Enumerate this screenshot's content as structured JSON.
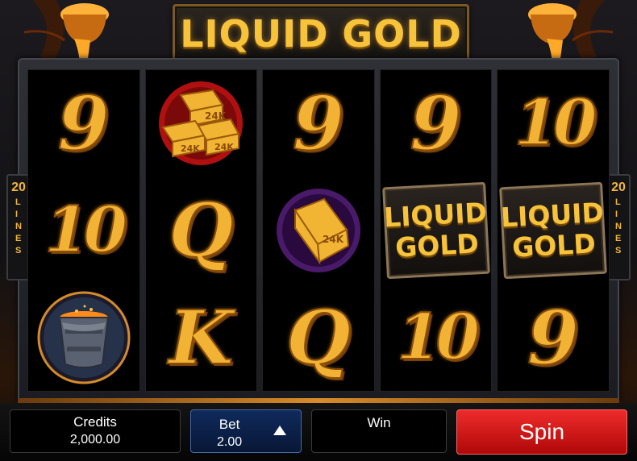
{
  "title": "LIQUID GOLD",
  "side_lines": {
    "number": "20",
    "word": [
      "L",
      "I",
      "N",
      "E",
      "S"
    ]
  },
  "reels": [
    [
      {
        "kind": "letter",
        "text": "9"
      },
      {
        "kind": "letter",
        "text": "10"
      },
      {
        "kind": "bucket",
        "text": ""
      }
    ],
    [
      {
        "kind": "goldbars",
        "text": "24K"
      },
      {
        "kind": "letter",
        "text": "Q"
      },
      {
        "kind": "letter",
        "text": "K"
      }
    ],
    [
      {
        "kind": "letter",
        "text": "9"
      },
      {
        "kind": "goldbar",
        "text": "24K"
      },
      {
        "kind": "letter",
        "text": "Q"
      }
    ],
    [
      {
        "kind": "letter",
        "text": "9"
      },
      {
        "kind": "logo",
        "text": [
          "LIQUID",
          "GOLD"
        ]
      },
      {
        "kind": "letter",
        "text": "10"
      }
    ],
    [
      {
        "kind": "letter",
        "text": "10"
      },
      {
        "kind": "logo",
        "text": [
          "LIQUID",
          "GOLD"
        ]
      },
      {
        "kind": "letter",
        "text": "9"
      }
    ]
  ],
  "panel": {
    "credits_label": "Credits",
    "credits_value": "2,000.00",
    "bet_label": "Bet",
    "bet_value": "2.00",
    "win_label": "Win",
    "win_value": "",
    "spin_label": "Spin"
  },
  "colors": {
    "gold": "#f2b233",
    "spin": "#d41414",
    "bet": "#0f2a5c"
  }
}
